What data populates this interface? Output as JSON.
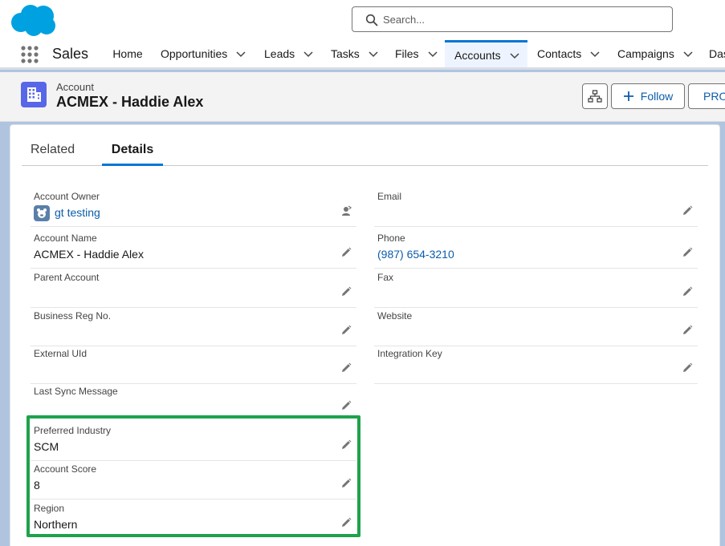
{
  "header": {
    "search": {
      "placeholder": "Search..."
    },
    "colors": {
      "brand": "#00a1e0",
      "accent": "#0176d3",
      "highlight": "#1fa24c"
    }
  },
  "nav": {
    "app_name": "Sales",
    "items": [
      {
        "label": "Home",
        "dropdown": false
      },
      {
        "label": "Opportunities",
        "dropdown": true
      },
      {
        "label": "Leads",
        "dropdown": true
      },
      {
        "label": "Tasks",
        "dropdown": true
      },
      {
        "label": "Files",
        "dropdown": true
      },
      {
        "label": "Accounts",
        "dropdown": true,
        "active": true
      },
      {
        "label": "Contacts",
        "dropdown": true
      },
      {
        "label": "Campaigns",
        "dropdown": true
      },
      {
        "label": "Das",
        "dropdown": false
      }
    ]
  },
  "record": {
    "type": "Account",
    "title": "ACMEX - Haddie Alex",
    "follow_label": "Follow",
    "more_label": "PROM"
  },
  "tabs": [
    {
      "label": "Related",
      "active": false
    },
    {
      "label": "Details",
      "active": true
    }
  ],
  "left_fields": [
    {
      "label": "Account Owner",
      "value": "gt testing",
      "link": true
    },
    {
      "label": "Account Name",
      "value": "ACMEX - Haddie Alex"
    },
    {
      "label": "Parent Account",
      "value": ""
    },
    {
      "label": "Business Reg No.",
      "value": ""
    },
    {
      "label": "External UId",
      "value": ""
    },
    {
      "label": "Last Sync Message",
      "value": ""
    },
    {
      "label": "Preferred Industry",
      "value": "SCM"
    },
    {
      "label": "Account Score",
      "value": "8"
    },
    {
      "label": "Region",
      "value": "Northern"
    }
  ],
  "right_fields": [
    {
      "label": "Email",
      "value": ""
    },
    {
      "label": "Phone",
      "value": "(987) 654-3210",
      "link": true
    },
    {
      "label": "Fax",
      "value": ""
    },
    {
      "label": "Website",
      "value": ""
    },
    {
      "label": "Integration Key",
      "value": ""
    }
  ]
}
